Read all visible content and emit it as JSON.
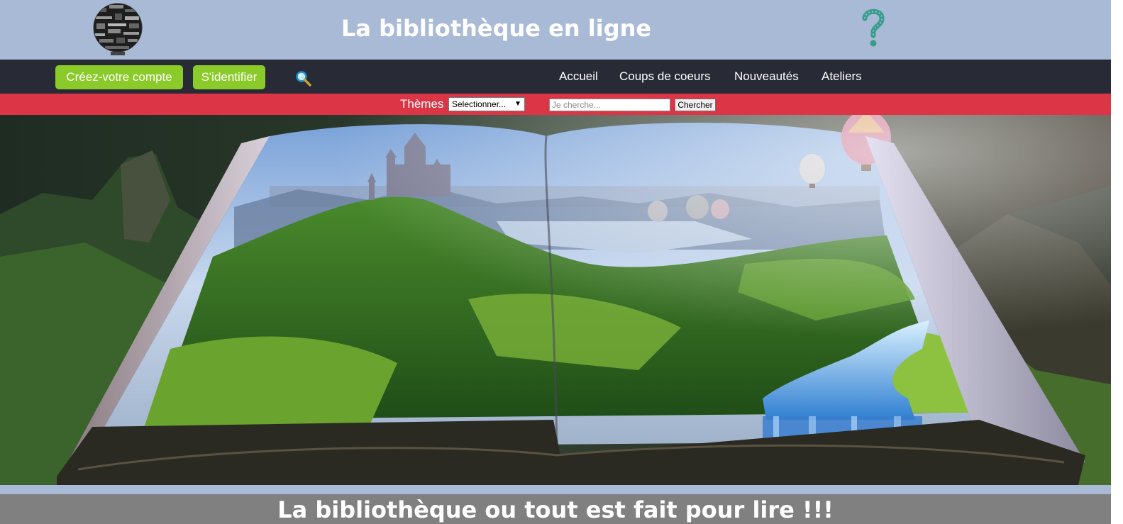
{
  "header": {
    "title": "La bibliothèque en ligne",
    "logo_icon": "round-word-cloud-logo",
    "help_icon": "question-mark-icon"
  },
  "nav": {
    "create_account": "Créez-votre compte",
    "login": "S'identifier",
    "search_icon": "magnifier-icon",
    "links": [
      "Accueil",
      "Coups de coeurs",
      "Nouveautés",
      "Ateliers"
    ]
  },
  "searchbar": {
    "themes_label": "Thèmes",
    "themes_selected": "Selectionner...",
    "search_placeholder": "Je cherche...",
    "search_value": "",
    "search_button": "Chercher"
  },
  "hero": {
    "image_description_icon": "open-book-landscape-image"
  },
  "tagline": "La bibliothèque ou tout est fait pour lire !!!",
  "colors": {
    "header_bg": "#a8bad6",
    "nav_bg": "#282a36",
    "button_green": "#8acb2a",
    "search_bar_red": "#dc3545",
    "tagline_bg": "#808080"
  }
}
